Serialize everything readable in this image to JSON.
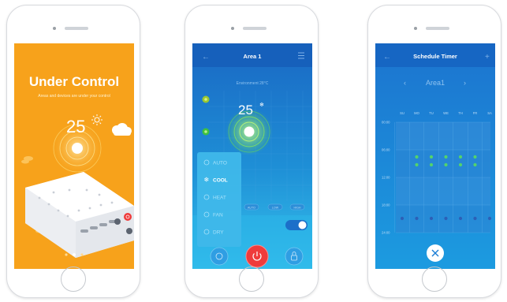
{
  "phone1": {
    "title": "Under Control",
    "subtitle": "Areas and devices are under your control",
    "temperature": "25",
    "bg": "#f7a21b"
  },
  "phone2": {
    "title": "Area 1",
    "environment": "Environment 28°C",
    "temperature": "25",
    "modes": [
      "AUTO",
      "COOL",
      "HEAT",
      "FAN",
      "DRY"
    ],
    "selected_mode": "COOL",
    "fan_labels": [
      "AUTO",
      "LOW",
      "HIGH"
    ],
    "toggle_on": true
  },
  "phone3": {
    "title": "Schedule Timer",
    "area": "Area1",
    "days": [
      "SU",
      "MO",
      "TU",
      "WE",
      "TH",
      "FR",
      "SA"
    ],
    "times": [
      "00:00",
      "06:00",
      "12:00",
      "18:00",
      "24:00"
    ]
  },
  "colors": {
    "accent_orange": "#f7a21b",
    "accent_blue": "#1e8fd6",
    "dot_green": "#53d36b",
    "dot_blue": "#2c5fb7",
    "power_red": "#ef3b3b"
  }
}
